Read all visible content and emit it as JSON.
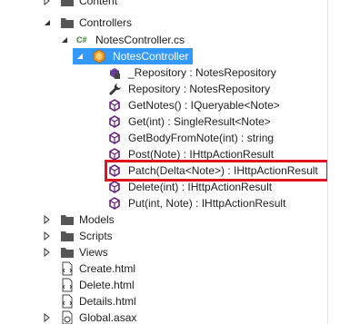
{
  "tree": {
    "items": [
      {
        "label": "Content",
        "icon": "folder-icon"
      },
      {
        "label": "Controllers",
        "icon": "folder-icon"
      },
      {
        "label": "NotesController.cs",
        "icon": "csharp-file-icon",
        "icon_text": "C#"
      },
      {
        "label": "NotesController",
        "icon": "class-icon"
      },
      {
        "label": "_Repository : NotesRepository",
        "icon": "private-field-icon"
      },
      {
        "label": "Repository : NotesRepository",
        "icon": "property-wrench-icon"
      },
      {
        "label": "GetNotes() : IQueryable<Note>",
        "icon": "method-icon"
      },
      {
        "label": "Get(int) : SingleResult<Note>",
        "icon": "method-icon"
      },
      {
        "label": "GetBodyFromNote(int) : string",
        "icon": "method-icon"
      },
      {
        "label": "Post(Note) : IHttpActionResult",
        "icon": "method-icon"
      },
      {
        "label": "Patch(Delta<Note>) : IHttpActionResult",
        "icon": "method-icon"
      },
      {
        "label": "Delete(int) : IHttpActionResult",
        "icon": "method-icon"
      },
      {
        "label": "Put(int, Note) : IHttpActionResult",
        "icon": "method-icon"
      },
      {
        "label": "Models",
        "icon": "folder-icon"
      },
      {
        "label": "Scripts",
        "icon": "folder-icon"
      },
      {
        "label": "Views",
        "icon": "folder-icon"
      },
      {
        "label": "Create.html",
        "icon": "html-file-icon"
      },
      {
        "label": "Delete.html",
        "icon": "html-file-icon"
      },
      {
        "label": "Details.html",
        "icon": "html-file-icon"
      },
      {
        "label": "Global.asax",
        "icon": "asax-file-icon"
      }
    ],
    "selected_label": "NotesController",
    "highlighted_label": "Patch(Delta<Note>) : IHttpActionResult"
  },
  "colors": {
    "selection": "#3399ff",
    "highlight_border": "#e0141e",
    "folder": "#555555",
    "method": "#68217a",
    "csharp": "#2a8a2a"
  }
}
